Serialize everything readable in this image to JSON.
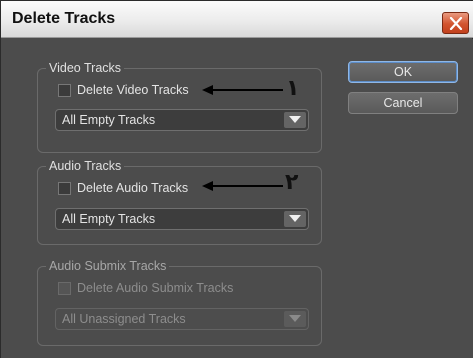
{
  "window": {
    "title": "Delete Tracks"
  },
  "buttons": {
    "ok_label": "OK",
    "cancel_label": "Cancel"
  },
  "video": {
    "group_title": "Video Tracks",
    "checkbox_label": "Delete Video Tracks",
    "checked": false,
    "select_value": "All Empty Tracks"
  },
  "audio": {
    "group_title": "Audio Tracks",
    "checkbox_label": "Delete Audio Tracks",
    "checked": false,
    "select_value": "All Empty Tracks"
  },
  "submix": {
    "group_title": "Audio Submix Tracks",
    "checkbox_label": "Delete Audio Submix Tracks",
    "checked": false,
    "disabled": true,
    "select_value": "All Unassigned Tracks"
  },
  "annotations": {
    "marker_1": "١",
    "marker_2": "٢"
  },
  "colors": {
    "dialog_bg": "#4c4c4c",
    "titlebar": "#ececec",
    "close_button": "#d2542f",
    "default_button_border": "#8fb7e6"
  }
}
